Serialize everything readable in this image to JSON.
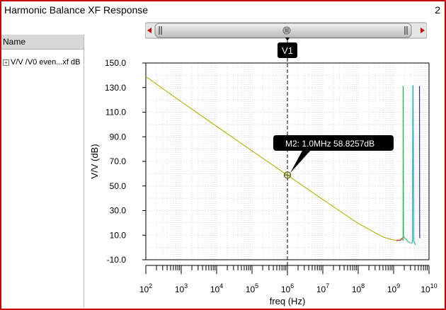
{
  "window": {
    "title": "Harmonic Balance XF Response",
    "panel_number": "2"
  },
  "browser": {
    "header": "Name",
    "trace_entry": "V/V /V0 even...xf dB"
  },
  "marker": {
    "vertical_label": "V1",
    "point_label": "M2: 1.0MHz 58.8257dB",
    "x": 1000000,
    "y": 58.8257
  },
  "colors": {
    "main_trace": "#b8ae00",
    "green_trace": "#1fb84a",
    "teal_trace": "#18a8b8",
    "navy_trace": "#20207a",
    "pink_trace": "#d0206a",
    "frame_border": "#c80000",
    "grid": "#d8d8d8"
  },
  "chart_data": {
    "type": "line",
    "title": "",
    "xlabel": "freq (Hz)",
    "ylabel": "V/V (dB)",
    "xscale": "log",
    "xlim": [
      100,
      10000000000
    ],
    "ylim": [
      -10,
      150
    ],
    "ytick_labels": [
      "150.0",
      "130.0",
      "110.0",
      "90.0",
      "70.0",
      "50.0",
      "30.0",
      "10.0",
      "-10.0"
    ],
    "ytick_values": [
      150,
      130,
      110,
      90,
      70,
      50,
      30,
      10,
      -10
    ],
    "xtick_values": [
      100,
      1000,
      10000,
      100000,
      1000000,
      10000000,
      100000000,
      1000000000,
      10000000000
    ],
    "xtick_labels": [
      {
        "base": "10",
        "exp": "2"
      },
      {
        "base": "10",
        "exp": "3"
      },
      {
        "base": "10",
        "exp": "4"
      },
      {
        "base": "10",
        "exp": "5"
      },
      {
        "base": "10",
        "exp": "6"
      },
      {
        "base": "10",
        "exp": "7"
      },
      {
        "base": "10",
        "exp": "8"
      },
      {
        "base": "10",
        "exp": "9"
      },
      {
        "base": "10",
        "exp": "10"
      }
    ],
    "grid": true,
    "series": [
      {
        "color": "#b8ae00",
        "points": [
          [
            100,
            139.0
          ],
          [
            1000,
            118.5
          ],
          [
            10000,
            98.5
          ],
          [
            100000,
            78.5
          ],
          [
            1000000,
            58.8
          ],
          [
            10000000,
            39.0
          ],
          [
            100000000,
            19.5
          ],
          [
            500000000,
            8.5
          ],
          [
            1000000000,
            6.0
          ],
          [
            1500000000,
            6.0
          ],
          [
            1800000000,
            8.0
          ]
        ]
      },
      {
        "color": "#d0206a",
        "points": [
          [
            1200000000,
            5.5
          ],
          [
            1600000000,
            6.0
          ],
          [
            1750000000,
            7.5
          ]
        ]
      },
      {
        "color": "#1fb84a",
        "points": [
          [
            1800000000,
            7.0
          ],
          [
            1850000000,
            5.5
          ],
          [
            1850000000,
            131.0
          ],
          [
            1870000000,
            131.0
          ],
          [
            1900000000,
            9.0
          ],
          [
            2500000000,
            5.0
          ],
          [
            3000000000,
            3.5
          ]
        ]
      },
      {
        "color": "#18a8b8",
        "points": [
          [
            3200000000,
            3.0
          ],
          [
            3400000000,
            4.5
          ],
          [
            3500000000,
            131.5
          ],
          [
            3550000000,
            131.5
          ],
          [
            3700000000,
            5.0
          ],
          [
            4200000000,
            2.0
          ]
        ]
      },
      {
        "color": "#20207a",
        "points": [
          [
            5300000000,
            131.0
          ],
          [
            5400000000,
            131.0
          ],
          [
            5450000000,
            8.5
          ],
          [
            5600000000,
            7.5
          ]
        ]
      }
    ]
  }
}
